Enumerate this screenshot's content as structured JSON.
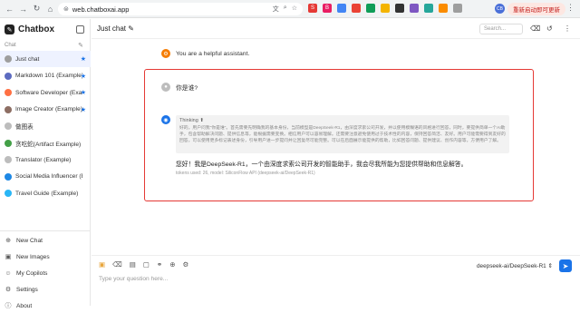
{
  "browser": {
    "url": "web.chatboxai.app",
    "update_label": "重新启动即可更新",
    "profile_initial": "CB",
    "extensions": [
      {
        "icon": "ext-s-icon",
        "glyph": "S",
        "color": "#e53935"
      },
      {
        "icon": "ext-pink-icon",
        "glyph": "B",
        "color": "#e91e63"
      },
      {
        "icon": "ext-blue-icon",
        "glyph": "",
        "color": "#4285f4"
      },
      {
        "icon": "ext-red-icon",
        "glyph": "",
        "color": "#ea4335"
      },
      {
        "icon": "ext-green-icon",
        "glyph": "",
        "color": "#0f9d58"
      },
      {
        "icon": "ext-yellow-icon",
        "glyph": "",
        "color": "#f4b400"
      },
      {
        "icon": "ext-dark-icon",
        "glyph": "",
        "color": "#333333"
      },
      {
        "icon": "ext-purple-icon",
        "glyph": "",
        "color": "#7e57c2"
      },
      {
        "icon": "ext-teal-icon",
        "glyph": "",
        "color": "#26a69a"
      },
      {
        "icon": "ext-orange-icon",
        "glyph": "",
        "color": "#fb8c00"
      },
      {
        "icon": "ext-gray-icon",
        "glyph": "",
        "color": "#9e9e9e"
      }
    ]
  },
  "sidebar": {
    "brand": "Chatbox",
    "section_label": "Chat",
    "sessions": [
      {
        "label": "Just chat",
        "icon_color": "#9e9e9e",
        "starred": true,
        "active": true
      },
      {
        "label": "Markdown 101 (Example)",
        "icon_color": "#5c6bc0",
        "starred": true,
        "active": false
      },
      {
        "label": "Software Developer (Example)",
        "icon_color": "#ff7043",
        "starred": true,
        "active": false
      },
      {
        "label": "Image Creator (Example)",
        "icon_color": "#8d6e63",
        "starred": true,
        "active": false
      },
      {
        "label": "做图表",
        "icon_color": "#bdbdbd",
        "starred": false,
        "active": false
      },
      {
        "label": "贪吃蛇(Artifact Example)",
        "icon_color": "#43a047",
        "starred": false,
        "active": false
      },
      {
        "label": "Translator (Example)",
        "icon_color": "#bdbdbd",
        "starred": false,
        "active": false
      },
      {
        "label": "Social Media Influencer (Example)",
        "icon_color": "#1e88e5",
        "starred": false,
        "active": false
      },
      {
        "label": "Travel Guide (Example)",
        "icon_color": "#29b6f6",
        "starred": false,
        "active": false
      }
    ],
    "bottom": [
      {
        "label": "New Chat",
        "icon": "plus-circle-icon",
        "glyph": "⊕"
      },
      {
        "label": "New Images",
        "icon": "image-icon",
        "glyph": "▣"
      },
      {
        "label": "My Copilots",
        "icon": "copilot-icon",
        "glyph": "☺"
      },
      {
        "label": "Settings",
        "icon": "gear-icon",
        "glyph": "⚙"
      },
      {
        "label": "About",
        "icon": "info-icon",
        "glyph": "ⓘ"
      }
    ]
  },
  "header": {
    "title": "Just chat",
    "search_placeholder": "Search..."
  },
  "messages": {
    "system_text": "You are a helpful assistant.",
    "user_text": "你是谁?",
    "think_label": "Thinking",
    "think_text": "好的，用户问我\"你是谁\"。首先需要先明确我的基本身份，当前模型是DeepSeek-R1，由深度求索公司开发，并以使用模糊语的风格进行回答，同时，要提供简单一个AI助手，包含帮助解决问题、提供信息等，能根据需要变换。相信用户可以容易理解。还需要注意避免使用过于技术性的内容，保持回答简洁、友好。用户可能需要得到友好的回答，可以使用更多标记表述身份，引导用户进一步提问并让回复尽可能完整。可以在后面展示能提供的帮助，比如回答问题、提供建议、创作内容等，方便用户了解。",
    "ai_text": "您好！我是DeepSeek-R1，一个由深度求索公司开发的智能助手，我会尽我所能为您提供帮助和信息解答。",
    "ai_meta": "tokens used: 26, model: SiliconFlow API (deepseek-ai/DeepSeek-R1)"
  },
  "input": {
    "placeholder": "Type your question here...",
    "model_label": "deepseek-ai/DeepSeek-R1"
  },
  "colors": {
    "accent": "#1a73e8",
    "highlight": "#e53935"
  }
}
